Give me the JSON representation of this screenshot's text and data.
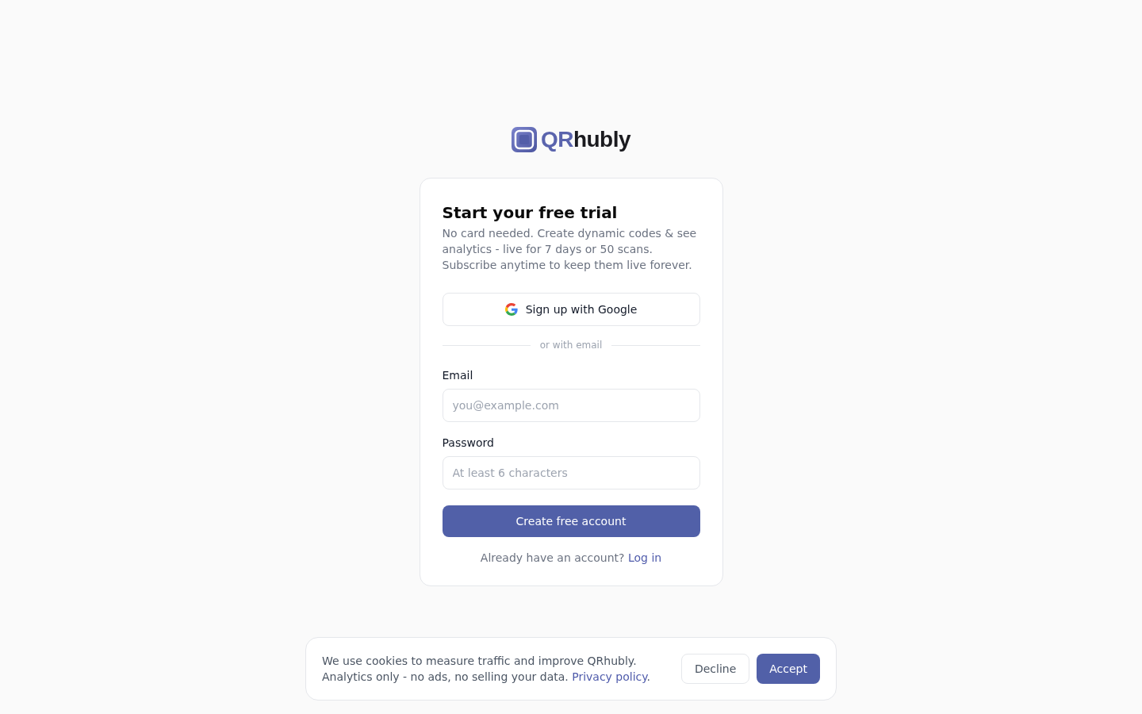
{
  "logo": {
    "accent": "QR",
    "rest": "hubly"
  },
  "card": {
    "title": "Start your free trial",
    "description": "No card needed. Create dynamic codes & see analytics - live for 7 days or 50 scans. Subscribe anytime to keep them live forever.",
    "google_button": "Sign up with Google",
    "divider": "or with email",
    "fields": [
      {
        "label": "Email",
        "placeholder": "you@example.com"
      },
      {
        "label": "Password",
        "placeholder": "At least 6 characters"
      }
    ],
    "submit_button": "Create free account",
    "login_prompt": {
      "text": "Already have an account?",
      "link": "Log in"
    }
  },
  "cookie_banner": {
    "line_1": "We use cookies to measure traffic and improve QRhubly.",
    "line_2": "Analytics only - no ads, no selling your data.",
    "link": "Privacy policy",
    "after_link": ".",
    "buttons": [
      {
        "kind": "secondary",
        "label": "Decline"
      },
      {
        "kind": "primary",
        "label": "Accept"
      }
    ]
  }
}
